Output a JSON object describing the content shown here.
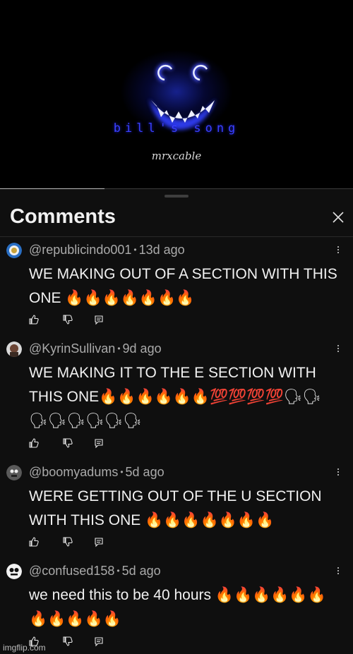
{
  "video": {
    "title_overlay": "bill's song",
    "author_overlay": "mrxcable",
    "progress_fraction": 0.295,
    "glow_color": "#2b33ff"
  },
  "comments_panel": {
    "title": "Comments",
    "close_icon": "close-icon",
    "comments": [
      {
        "author": "@republicindo001",
        "separator": "•",
        "time": "13d ago",
        "text": "WE MAKING OUT OF A SECTION WITH THIS ONE 🔥🔥🔥🔥🔥🔥🔥",
        "avatar_color": "#4a8bd6"
      },
      {
        "author": "@KyrinSullivan",
        "separator": "•",
        "time": "9d ago",
        "text": "WE MAKING IT TO THE E SECTION WITH THIS ONE🔥🔥🔥🔥🔥🔥💯💯💯💯🗣🗣🗣🗣🗣🗣🗣🗣",
        "avatar_color": "#7a5a4a"
      },
      {
        "author": "@boomyadums",
        "separator": "•",
        "time": "5d ago",
        "text": "WERE GETTING OUT OF THE U SECTION WITH THIS ONE 🔥🔥🔥🔥🔥🔥🔥",
        "avatar_color": "#6a6a6a"
      },
      {
        "author": "@confused158",
        "separator": "•",
        "time": "5d ago",
        "text": "we need this to be 40 hours 🔥🔥🔥🔥🔥🔥🔥🔥🔥🔥🔥",
        "avatar_color": "#e8e8e8"
      }
    ]
  },
  "watermark": "imgflip.com"
}
